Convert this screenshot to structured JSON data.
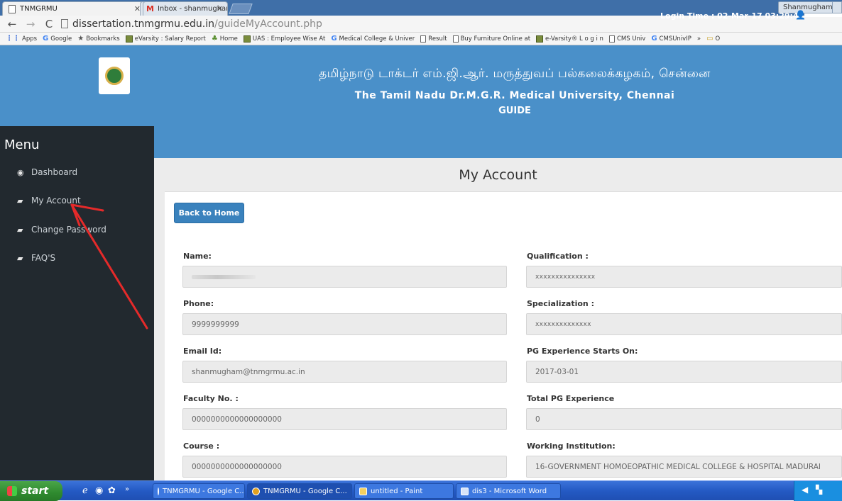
{
  "browser": {
    "tabs": [
      {
        "title": "TNMGRMU",
        "active": true
      },
      {
        "title": "Inbox - shanmugham@tnmgr",
        "active": false
      }
    ],
    "profile_name": "Shanmugham",
    "url_host": "dissertation.tnmgrmu.edu.in",
    "url_path": "/guideMyAccount.php",
    "bookmarks": [
      {
        "icon": "apps-icon",
        "label": "Apps"
      },
      {
        "icon": "google-icon",
        "label": "Google"
      },
      {
        "icon": "star-icon",
        "label": "Bookmarks"
      },
      {
        "icon": "evarsity-icon",
        "label": "eVarsity : Salary Report"
      },
      {
        "icon": "home-icon",
        "label": "Home"
      },
      {
        "icon": "evarsity-icon",
        "label": "UAS : Employee Wise At"
      },
      {
        "icon": "google-icon",
        "label": "Medical College & Univer"
      },
      {
        "icon": "page-icon",
        "label": "Result"
      },
      {
        "icon": "page-icon",
        "label": "Buy Furniture Online at"
      },
      {
        "icon": "evarsity-icon",
        "label": "e-Varsity® L o g i n"
      },
      {
        "icon": "page-icon",
        "label": "CMS Univ"
      },
      {
        "icon": "google-icon",
        "label": "CMSUnivIP"
      },
      {
        "icon": "overflow-icon",
        "label": "»"
      },
      {
        "icon": "folder-icon",
        "label": "O"
      }
    ]
  },
  "header": {
    "tamil_title": "தமிழ்நாடு டாக்டர் எம்.ஜி.ஆர். மருத்துவப் பல்கலைக்கழகம், சென்னை",
    "english_title": "The Tamil Nadu Dr.M.G.R. Medical University, Chennai",
    "role": "GUIDE"
  },
  "sidebar": {
    "title": "Menu",
    "items": [
      {
        "label": "Dashboard",
        "icon": "dashboard-icon"
      },
      {
        "label": "My Account",
        "icon": "book-icon"
      },
      {
        "label": "Change Password",
        "icon": "book-icon"
      },
      {
        "label": "FAQ'S",
        "icon": "book-icon"
      }
    ]
  },
  "topbar": {
    "login_time": "Login Time : 02-Mar-17 03:29:45"
  },
  "page": {
    "title": "My Account",
    "back_button": "Back to Home"
  },
  "form": {
    "name": {
      "label": "Name:",
      "value": ""
    },
    "qualification": {
      "label": "Qualification :",
      "value": "xxxxxxxxxxxxxxx"
    },
    "phone": {
      "label": "Phone:",
      "value": "9999999999"
    },
    "specialization": {
      "label": "Specialization :",
      "value": "xxxxxxxxxxxxxx"
    },
    "email": {
      "label": "Email Id:",
      "value": "shanmugham@tnmgrmu.ac.in"
    },
    "pg_start": {
      "label": "PG Experience Starts On:",
      "value": "2017-03-01"
    },
    "faculty_no": {
      "label": "Faculty No. :",
      "value": "0000000000000000000"
    },
    "total_pg": {
      "label": "Total PG Experience",
      "value": "0"
    },
    "course": {
      "label": "Course :",
      "value": "0000000000000000000"
    },
    "institution": {
      "label": "Working Institution:",
      "value": "16-GOVERNMENT HOMOEOPATHIC MEDICAL COLLEGE & HOSPITAL  MADURAI"
    }
  },
  "taskbar": {
    "start_label": "start",
    "tasks": [
      {
        "label": "TNMGRMU - Google C...",
        "active": false
      },
      {
        "label": "TNMGRMU - Google C...",
        "active": true
      },
      {
        "label": "untitled - Paint",
        "active": false
      },
      {
        "label": "dis3 - Microsoft Word",
        "active": false
      }
    ]
  },
  "colors": {
    "header_blue": "#4a90c9",
    "sidebar_dark": "#22292f",
    "button_blue": "#3a82bd",
    "annotation_red": "#e52a2a"
  }
}
